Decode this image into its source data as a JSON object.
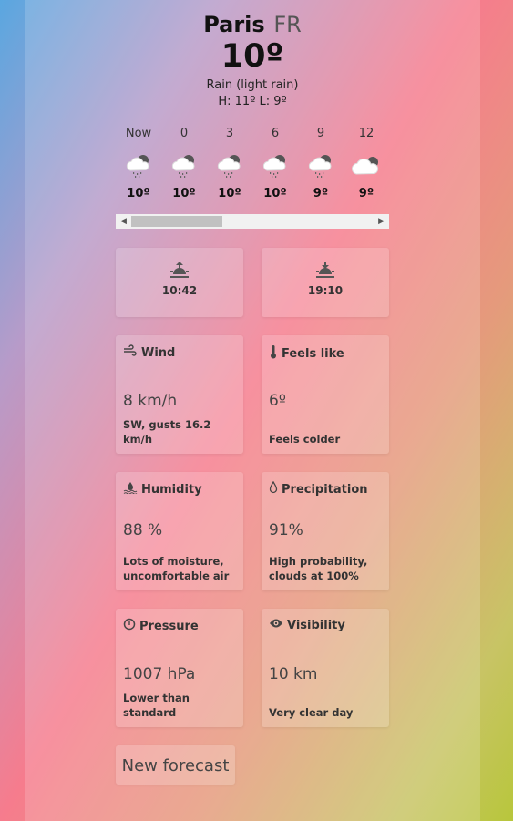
{
  "location": {
    "city": "Paris",
    "country": "FR"
  },
  "current": {
    "temperature": "10º",
    "condition": "Rain (light rain)",
    "high_low": "H: 11º L: 9º"
  },
  "hourly": [
    {
      "time": "Now",
      "icon": "cloud-rain-icon",
      "temp": "10º"
    },
    {
      "time": "0",
      "icon": "cloud-rain-icon",
      "temp": "10º"
    },
    {
      "time": "3",
      "icon": "cloud-rain-icon",
      "temp": "10º"
    },
    {
      "time": "6",
      "icon": "cloud-rain-icon",
      "temp": "10º"
    },
    {
      "time": "9",
      "icon": "cloud-rain-icon",
      "temp": "9º"
    },
    {
      "time": "12",
      "icon": "cloud-icon",
      "temp": "9º"
    }
  ],
  "sun": {
    "sunrise": "10:42",
    "sunset": "19:10"
  },
  "stats": {
    "wind": {
      "title": "Wind",
      "value": "8 km/h",
      "desc": "SW, gusts 16.2 km/h",
      "icon": "wind-icon"
    },
    "feels_like": {
      "title": "Feels like",
      "value": "6º",
      "desc": "Feels colder",
      "icon": "thermometer-icon"
    },
    "humidity": {
      "title": "Humidity",
      "value": "88 %",
      "desc": "Lots of moisture, uncomfortable air",
      "icon": "humidity-icon"
    },
    "precipitation": {
      "title": "Precipitation",
      "value": "91%",
      "desc": "High probability, clouds at 100%",
      "icon": "droplet-icon"
    },
    "pressure": {
      "title": "Pressure",
      "value": "1007 hPa",
      "desc": "Lower than standard",
      "icon": "gauge-icon"
    },
    "visibility": {
      "title": "Visibility",
      "value": "10 km",
      "desc": "Very clear day",
      "icon": "eye-icon"
    }
  },
  "actions": {
    "new_forecast": "New forecast"
  }
}
